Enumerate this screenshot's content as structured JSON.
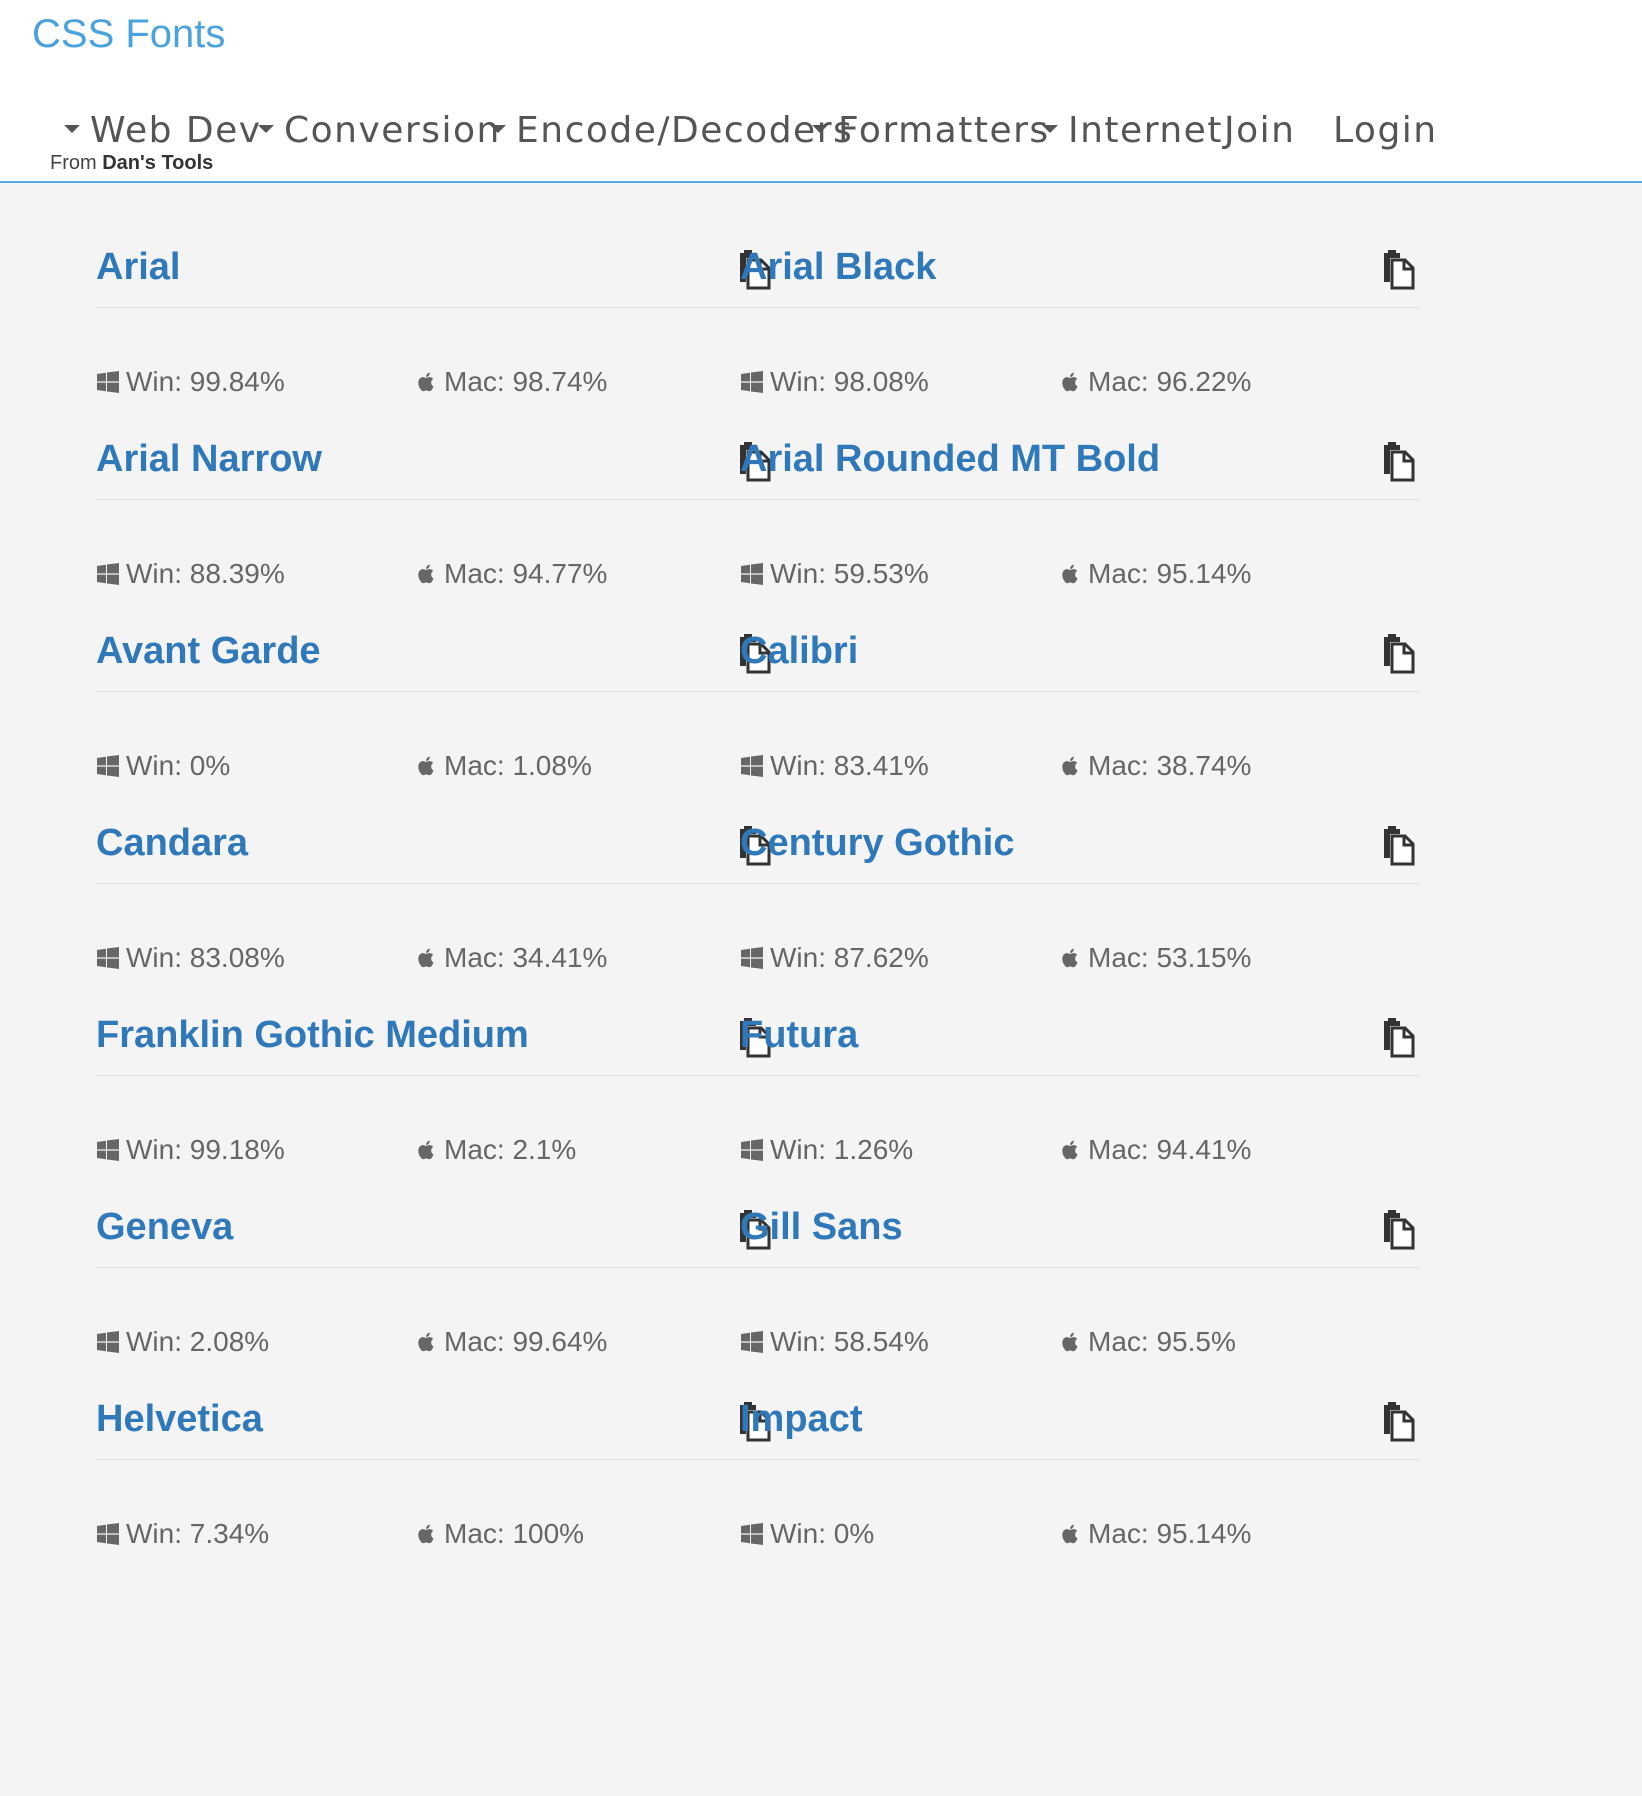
{
  "header": {
    "site_title": "CSS Fonts",
    "nav": [
      {
        "label": "Web Dev",
        "dropdown": true
      },
      {
        "label": "Conversion",
        "dropdown": true
      },
      {
        "label": "Encode/Decoders",
        "dropdown": true
      },
      {
        "label": "Formatters",
        "dropdown": true
      },
      {
        "label": "Internet",
        "dropdown": true
      },
      {
        "label": "Join",
        "dropdown": false
      },
      {
        "label": "Login",
        "dropdown": false
      }
    ],
    "sub_note_prefix": "From",
    "sub_note_brand": "Dan's Tools"
  },
  "fonts": [
    {
      "name": "Arial",
      "win": "Win: 99.84%",
      "mac": "Mac: 98.74%"
    },
    {
      "name": "Arial Black",
      "win": "Win: 98.08%",
      "mac": "Mac: 96.22%"
    },
    {
      "name": "Arial Narrow",
      "win": "Win: 88.39%",
      "mac": "Mac: 94.77%"
    },
    {
      "name": "Arial Rounded MT Bold",
      "win": "Win: 59.53%",
      "mac": "Mac: 95.14%"
    },
    {
      "name": "Avant Garde",
      "win": "Win: 0%",
      "mac": "Mac: 1.08%"
    },
    {
      "name": "Calibri",
      "win": "Win: 83.41%",
      "mac": "Mac: 38.74%"
    },
    {
      "name": "Candara",
      "win": "Win: 83.08%",
      "mac": "Mac: 34.41%"
    },
    {
      "name": "Century Gothic",
      "win": "Win: 87.62%",
      "mac": "Mac: 53.15%"
    },
    {
      "name": "Franklin Gothic Medium",
      "win": "Win: 99.18%",
      "mac": "Mac: 2.1%"
    },
    {
      "name": "Futura",
      "win": "Win: 1.26%",
      "mac": "Mac: 94.41%"
    },
    {
      "name": "Geneva",
      "win": "Win: 2.08%",
      "mac": "Mac: 99.64%"
    },
    {
      "name": "Gill Sans",
      "win": "Win: 58.54%",
      "mac": "Mac: 95.5%"
    },
    {
      "name": "Helvetica",
      "win": "Win: 7.34%",
      "mac": "Mac: 100%"
    },
    {
      "name": "Impact",
      "win": "Win: 0%",
      "mac": "Mac: 95.14%"
    }
  ],
  "colors": {
    "title": "#4aa3df",
    "font_name": "#2f78b9",
    "nav_text": "#555555",
    "stat_text": "#666666",
    "accent_border": "#5aa9e0",
    "background": "#f4f4f4"
  },
  "icons": {
    "copy": "copy-icon",
    "windows": "windows-icon",
    "apple": "apple-icon",
    "dropdown": "caret-down-icon"
  }
}
